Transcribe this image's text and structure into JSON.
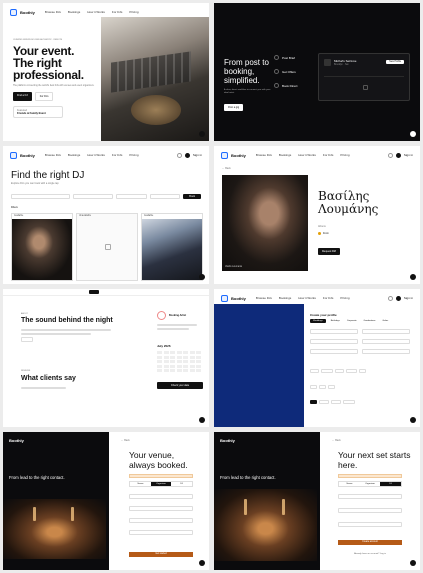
{
  "nav": {
    "brand": "Boothly",
    "links": [
      "Browse DJs",
      "Bookings",
      "How it Works",
      "For DJs",
      "Pricing"
    ],
    "sign_in": "Sign in"
  },
  "p1": {
    "eyebrow": "CURATED MIXERS BOOKED AUTHENTIC · REMOTE",
    "headline": "Your event. The right professional.",
    "sub": "The platform connecting the world's best DJs with venues and event organizers.",
    "btn_primary": "Find a DJ",
    "btn_secondary": "For DJs",
    "featured_label": "Featured",
    "featured_value": "Friends & Family Event"
  },
  "p2": {
    "headline": "From post to booking, simplified.",
    "sub": "A clear, direct workflow to connect you with your ideal artist.",
    "btn": "Post a gig",
    "steps": [
      "Post Brief",
      "Get Offers",
      "Book Direct"
    ],
    "card_title": "Michal's Set/Live",
    "card_sub": "Brooklyn · Sat",
    "card_badge": "New Profile"
  },
  "p3": {
    "title": "Find the right DJ",
    "sub": "Explore DJs you can book with a single tap",
    "search_btn": "Book",
    "filters_label": "Filters",
    "cards": [
      "Available",
      "Unavailable",
      "Available"
    ]
  },
  "p4": {
    "back": "← Back",
    "name": "Βασίλης Λουμάνης",
    "role": "Athens",
    "price": "From",
    "cta": "Request DM",
    "photo_caption": "Vasilis Loumanis"
  },
  "p5": {
    "section1": "ABOUT",
    "heading1": "The sound behind the night",
    "section2": "REVIEWS",
    "heading2": "What clients say",
    "book_btn": "Check your date",
    "calendar_month": "July 2026",
    "name": "Booking Artist"
  },
  "p6": {
    "title": "Create your profile",
    "tabs": [
      "Weddings",
      "Birthdays",
      "Corporate",
      "Graduations",
      "Galas"
    ],
    "submit": "Submit"
  },
  "p7": {
    "caption": "From lead to the right contact.",
    "back": "← Back",
    "headline": "Your venue, always booked.",
    "tabs": [
      "Venue",
      "Organizer",
      "DJ"
    ],
    "submit": "Get started"
  },
  "p8": {
    "caption": "From lead to the right contact.",
    "back": "← Back",
    "headline": "Your next set starts here.",
    "tabs": [
      "Venue",
      "Organizer",
      "DJ"
    ],
    "submit": "Create account",
    "footer_link": "Already have an account? Log in"
  }
}
